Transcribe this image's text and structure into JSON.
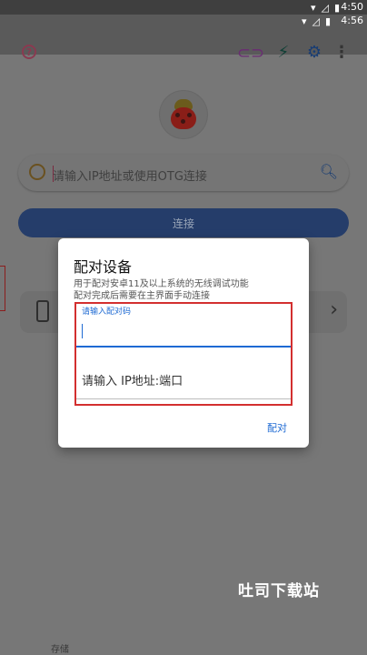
{
  "status": {
    "outer_time": "4:50",
    "inner_time": "4:56"
  },
  "app": {
    "search_placeholder": "请输入IP地址或使用OTG连接",
    "connect_label": "连接",
    "bottom_text": "存储"
  },
  "dialog": {
    "title": "配对设备",
    "subtitle_line1": "用于配对安卓11及以上系统的无线调试功能",
    "subtitle_line2": "配对完成后需要在主界面手动连接",
    "pair_code_label": "请输入配对码",
    "ip_placeholder": "请输入 IP地址:端口",
    "pair_button": "配对"
  },
  "watermark": "吐司下载站",
  "colors": {
    "accent_blue": "#1e6ad3",
    "highlight_red": "#d32f2f",
    "dim_overlay": "#777777"
  }
}
